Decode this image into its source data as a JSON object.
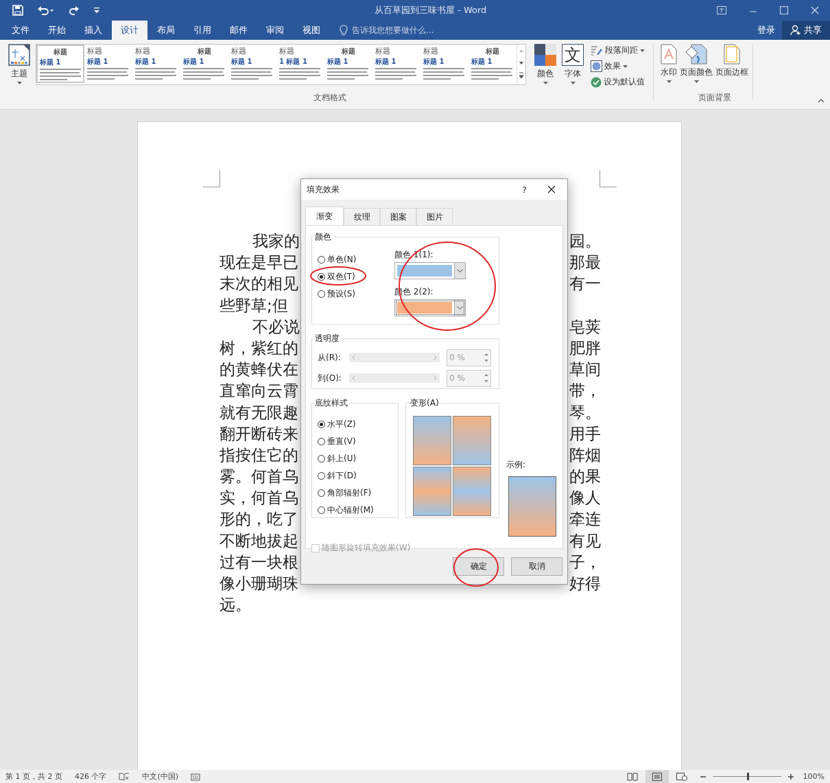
{
  "window": {
    "title": "从百草园到三味书屋 - Word"
  },
  "ribbon_tabs": [
    {
      "label": "文件",
      "selected": false
    },
    {
      "label": "开始",
      "selected": false
    },
    {
      "label": "插入",
      "selected": false
    },
    {
      "label": "设计",
      "selected": true
    },
    {
      "label": "布局",
      "selected": false
    },
    {
      "label": "引用",
      "selected": false
    },
    {
      "label": "邮件",
      "selected": false
    },
    {
      "label": "审阅",
      "selected": false
    },
    {
      "label": "视图",
      "selected": false
    }
  ],
  "tell_me": {
    "placeholder": "告诉我您想要做什么..."
  },
  "sign_in": "登录",
  "share": "共享",
  "theme_button": {
    "label": "主题"
  },
  "style_gallery": [
    {
      "heading": "标题",
      "subheading": "标题 1",
      "selected": true
    },
    {
      "heading": "标题",
      "subheading": "标题 1",
      "selected": false
    },
    {
      "heading": "标题",
      "subheading": "标题 1",
      "selected": false
    },
    {
      "heading": "标题",
      "subheading": "标题 1",
      "selected": false
    },
    {
      "heading": "标题",
      "subheading": "标题 1",
      "selected": false
    },
    {
      "heading": "标题",
      "subheading": "1 标题 1",
      "selected": false
    },
    {
      "heading": "标题",
      "subheading": "标题 1",
      "selected": false
    },
    {
      "heading": "标题",
      "subheading": "标题 1",
      "selected": false
    },
    {
      "heading": "标题",
      "subheading": "标题 1",
      "selected": false
    },
    {
      "heading": "标题",
      "subheading": "标题 1",
      "selected": false
    }
  ],
  "colors_button": {
    "label": "颜色"
  },
  "fonts_button": {
    "label": "字体",
    "glyph": "文"
  },
  "small_buttons": [
    {
      "label": "段落间距",
      "dropdown": true
    },
    {
      "label": "效果",
      "dropdown": true
    },
    {
      "label": "设为默认值",
      "dropdown": false
    }
  ],
  "group_labels": [
    "文档格式",
    "页面背景"
  ],
  "page_background": [
    {
      "label": "水印",
      "dropdown": true
    },
    {
      "label": "页面颜色",
      "dropdown": true
    },
    {
      "label": "页面边框",
      "dropdown": false
    }
  ],
  "document_lines": [
    {
      "left": "我家的",
      "right": "园。",
      "indent": true
    },
    {
      "left": "现在是早已",
      "right": "那最",
      "indent": false
    },
    {
      "left": "末次的相见",
      "right": "有一",
      "indent": false
    },
    {
      "left": "些野草;但",
      "indent": false
    },
    {
      "left": "不必说",
      "right": "皂荚",
      "indent": true
    },
    {
      "left": "树，紫红的",
      "right": "肥胖",
      "indent": false
    },
    {
      "left": "的黄蜂伏在",
      "right": "草间",
      "indent": false
    },
    {
      "left": "直窜向云霄",
      "right": "带，",
      "indent": false
    },
    {
      "left": "就有无限趣",
      "right": "琴。",
      "indent": false
    },
    {
      "left": "翻开断砖来",
      "right": "用手",
      "indent": false
    },
    {
      "left": "指按住它的",
      "right": "阵烟",
      "indent": false
    },
    {
      "left": "雾。何首乌",
      "right": "的果",
      "indent": false
    },
    {
      "left": "实，何首乌",
      "right": "像人",
      "indent": false
    },
    {
      "left": "形的，吃了",
      "right": "牵连",
      "indent": false
    },
    {
      "left": "不断地拔起",
      "right": "有见",
      "indent": false
    },
    {
      "left": "过有一块根",
      "right": "子，",
      "indent": false
    },
    {
      "left": "像小珊瑚珠",
      "right": "好得",
      "indent": false
    },
    {
      "left": "远。",
      "indent": false
    }
  ],
  "dialog": {
    "title": "填充效果",
    "help": "?",
    "tabs": [
      {
        "label": "渐变",
        "selected": true
      },
      {
        "label": "纹理",
        "selected": false
      },
      {
        "label": "图案",
        "selected": false
      },
      {
        "label": "图片",
        "selected": false
      }
    ],
    "color_group": {
      "title": "颜色",
      "options": [
        {
          "label": "单色(N)",
          "selected": false
        },
        {
          "label": "双色(T)",
          "selected": true
        },
        {
          "label": "预设(S)",
          "selected": false
        }
      ],
      "pickers": [
        {
          "label": "颜色 1(1):",
          "color": "#9dc3e6"
        },
        {
          "label": "颜色 2(2):",
          "color": "#f4b183"
        }
      ]
    },
    "transparency": {
      "title": "透明度",
      "rows": [
        {
          "label": "从(R):",
          "value": "0 %",
          "disabled": true
        },
        {
          "label": "到(O):",
          "value": "0 %",
          "disabled": true
        }
      ]
    },
    "shading": {
      "title": "底纹样式",
      "options": [
        {
          "label": "水平(Z)",
          "selected": true
        },
        {
          "label": "垂直(V)",
          "selected": false
        },
        {
          "label": "斜上(U)",
          "selected": false
        },
        {
          "label": "斜下(D)",
          "selected": false
        },
        {
          "label": "角部辐射(F)",
          "selected": false
        },
        {
          "label": "中心辐射(M)",
          "selected": false
        }
      ]
    },
    "variants_title": "变形(A)",
    "sample_label": "示例:",
    "rotate_checkbox": {
      "label": "随图形旋转填充效果(W)",
      "checked": false,
      "disabled": true
    },
    "buttons": [
      "确定",
      "取消"
    ]
  },
  "status_bar": {
    "page": "第 1 页，共 2 页",
    "words": "426 个字",
    "language": "中文(中国)",
    "zoom": "100%",
    "zoom_level": {
      "level": 0.5
    },
    "views": [
      {
        "selected": false
      },
      {
        "selected": true
      },
      {
        "selected": false
      }
    ]
  }
}
